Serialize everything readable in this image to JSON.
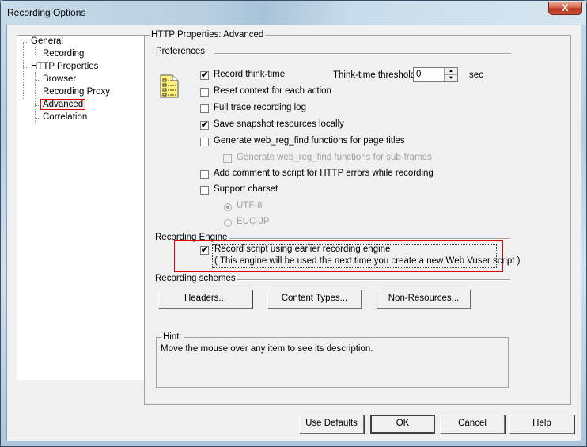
{
  "window": {
    "title": "Recording Options",
    "close_label": "X"
  },
  "tree": {
    "items": [
      {
        "label": "General",
        "level": 0
      },
      {
        "label": "Recording",
        "level": 1
      },
      {
        "label": "HTTP Properties",
        "level": 0
      },
      {
        "label": "Browser",
        "level": 1
      },
      {
        "label": "Recording Proxy",
        "level": 1
      },
      {
        "label": "Advanced",
        "level": 1,
        "selected": true
      },
      {
        "label": "Correlation",
        "level": 1
      }
    ]
  },
  "panel": {
    "title": "HTTP Properties: Advanced",
    "preferences": {
      "title": "Preferences",
      "icon": "checklist-notepad-icon",
      "record_think_time": {
        "label": "Record think-time",
        "checked": true
      },
      "think_time_threshold": {
        "label": "Think-time threshold:",
        "value": "0",
        "unit": "sec"
      },
      "reset_context": {
        "label": "Reset context for each action",
        "checked": false
      },
      "full_trace": {
        "label": "Full trace recording log",
        "checked": false
      },
      "save_snapshot": {
        "label": "Save snapshot resources locally",
        "checked": true
      },
      "gen_web_reg_find": {
        "label": "Generate web_reg_find functions for page titles",
        "checked": false
      },
      "gen_web_reg_find_sub": {
        "label": "Generate web_reg_find functions for sub-frames",
        "checked": false,
        "disabled": true
      },
      "add_comment": {
        "label": "Add comment to script for HTTP errors while recording",
        "checked": false
      },
      "support_charset": {
        "label": "Support charset",
        "checked": false
      },
      "charset_options": [
        {
          "label": "UTF-8",
          "selected": true,
          "disabled": true
        },
        {
          "label": "EUC-JP",
          "selected": false,
          "disabled": true
        }
      ]
    },
    "recording_engine": {
      "title": "Recording Engine",
      "checkbox": {
        "label_line1": "Record script using earlier recording engine",
        "label_line2": "( This engine will be used the next time you create a new Web Vuser script )",
        "checked": true
      }
    },
    "recording_schemes": {
      "title": "Recording schemes",
      "buttons": [
        "Headers...",
        "Content Types...",
        "Non-Resources..."
      ]
    },
    "hint": {
      "title": "Hint:",
      "text": "Move the mouse over any item to see its description."
    }
  },
  "footer": {
    "use_defaults": "Use Defaults",
    "ok": "OK",
    "cancel": "Cancel",
    "help": "Help"
  },
  "colors": {
    "highlight_red": "#e00000",
    "dialog_bg": "#f0f0f0"
  }
}
